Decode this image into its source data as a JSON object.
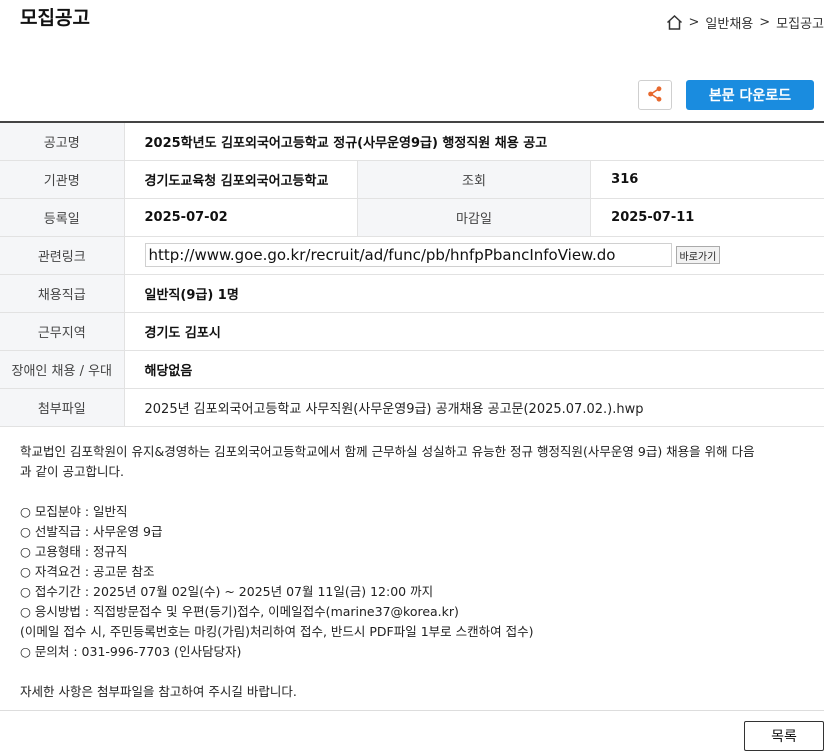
{
  "page_title": "모집공고",
  "breadcrumb": {
    "separator": ">",
    "items": [
      "일반채용",
      "모집공고"
    ]
  },
  "actions": {
    "download_label": "본문 다운로드"
  },
  "table": {
    "title_label": "공고명",
    "title_value": "2025학년도 김포외국어고등학교 정규(사무운영9급) 행정직원 채용 공고",
    "org_label": "기관명",
    "org_value": "경기도교육청 김포외국어고등학교",
    "views_label": "조회",
    "views_value": "316",
    "reg_label": "등록일",
    "reg_value": "2025-07-02",
    "deadline_label": "마감일",
    "deadline_value": "2025-07-11",
    "link_label": "관련링크",
    "link_value": "http://www.goe.go.kr/recruit/ad/func/pb/hnfpPbancInfoView.do",
    "link_button": "바로가기",
    "position_label": "채용직급",
    "position_value": "일반직(9급) 1명",
    "region_label": "근무지역",
    "region_value": "경기도 김포시",
    "disability_label": "장애인 채용 / 우대",
    "disability_value": "해당없음",
    "attachment_label": "첨부파일",
    "attachment_value": "2025년 김포외국어고등학교 사무직원(사무운영9급) 공개채용 공고문(2025.07.02.).hwp"
  },
  "body": {
    "intro_line1": "학교법인 김포학원이 유지&경영하는 김포외국어고등학교에서 함께 근무하실 성실하고 유능한 정규 행정직원(사무운영 9급) 채용을 위해 다음",
    "intro_line2": "과 같이 공고합니다.",
    "items": [
      "○ 모집분야 : 일반직",
      "○ 선발직급 : 사무운영 9급",
      "○ 고용형태 : 정규직",
      "○ 자격요건 : 공고문 참조",
      "○ 접수기간 : 2025년 07월 02일(수) ~ 2025년 07월 11일(금) 12:00 까지",
      "○ 응시방법 : 직접방문접수 및 우편(등기)접수, 이메일접수(marine37@korea.kr)",
      "(이메일 접수 시, 주민등록번호는 마킹(가림)처리하여 접수, 반드시 PDF파일 1부로 스캔하여 접수)",
      "○ 문의처 : 031-996-7703 (인사담당자)"
    ],
    "closing": "자세한 사항은 첨부파일을 참고하여 주시길 바랍니다."
  },
  "footer": {
    "list_button": "목록"
  },
  "colors": {
    "accent": "#1a8cdf",
    "share_icon": "#e8692e",
    "header_cell": "#f5f6f8"
  },
  "icons": {
    "home": "home-icon",
    "share": "share-icon"
  }
}
